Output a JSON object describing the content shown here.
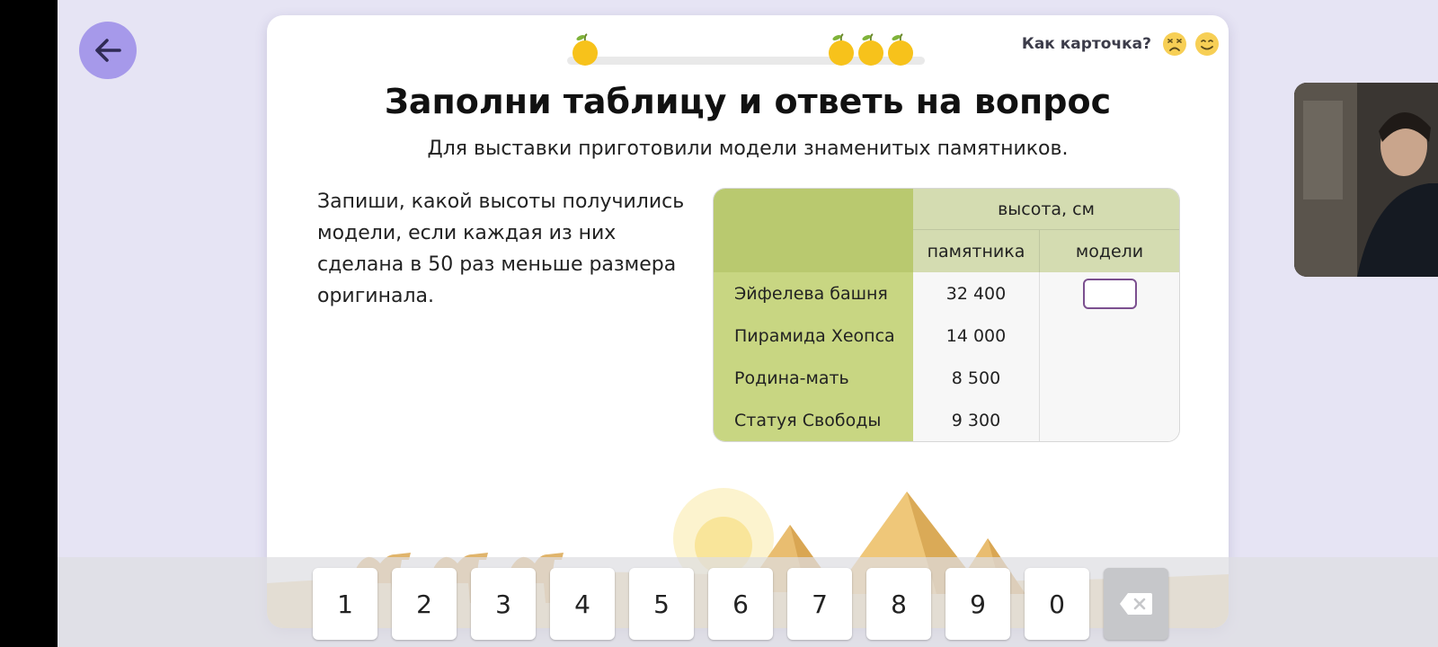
{
  "header": {
    "rate_label": "Как карточка?",
    "progress_fruits": 4,
    "rate_icons": [
      "frown-face-icon",
      "smile-face-icon"
    ]
  },
  "task": {
    "title": "Заполни таблицу и ответь на вопрос",
    "subtitle": "Для выставки приготовили модели знаменитых памятников.",
    "instruction": "Запиши, какой высоты получились модели, если каждая из них сделана в 50 раз меньше размера оригинала."
  },
  "table": {
    "group_header": "высота, см",
    "col_original": "памятника",
    "col_model": "модели",
    "rows": [
      {
        "name": "Эйфелева башня",
        "original": "32 400",
        "model": ""
      },
      {
        "name": "Пирамида Хеопса",
        "original": "14 000",
        "model": ""
      },
      {
        "name": "Родина-мать",
        "original": "8 500",
        "model": ""
      },
      {
        "name": "Статуя Свободы",
        "original": "9 300",
        "model": ""
      }
    ]
  },
  "keyboard": {
    "keys": [
      "1",
      "2",
      "3",
      "4",
      "5",
      "6",
      "7",
      "8",
      "9",
      "0"
    ],
    "backspace_icon": "backspace-icon"
  },
  "colors": {
    "accent": "#a699ea",
    "table_label": "#c8d682",
    "table_header": "#d4dcb1",
    "input_border": "#7b4f8f"
  }
}
